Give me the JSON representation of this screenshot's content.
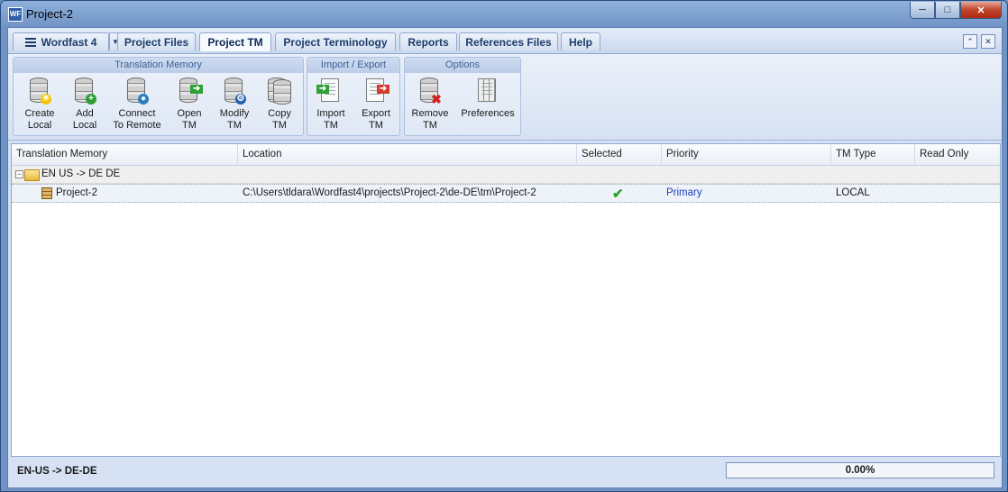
{
  "window": {
    "title": "Project-2",
    "icon_text": "WF"
  },
  "tabs": [
    {
      "label": "Wordfast 4"
    },
    {
      "label": "Project Files"
    },
    {
      "label": "Project TM"
    },
    {
      "label": "Project Terminology"
    },
    {
      "label": "Reports"
    },
    {
      "label": "References Files"
    },
    {
      "label": "Help"
    }
  ],
  "active_tab": "Project TM",
  "ribbon": {
    "groups": [
      {
        "title": "Translation Memory"
      },
      {
        "title": "Import / Export"
      },
      {
        "title": "Options"
      }
    ],
    "buttons": {
      "create_local": {
        "line1": "Create",
        "line2": "Local"
      },
      "add_local": {
        "line1": "Add",
        "line2": "Local"
      },
      "connect_remote": {
        "line1": "Connect",
        "line2": "To Remote"
      },
      "open_tm": {
        "line1": "Open",
        "line2": "TM"
      },
      "modify_tm": {
        "line1": "Modify",
        "line2": "TM"
      },
      "copy_tm": {
        "line1": "Copy",
        "line2": "TM"
      },
      "import_tm": {
        "line1": "Import",
        "line2": "TM"
      },
      "export_tm": {
        "line1": "Export",
        "line2": "TM"
      },
      "remove_tm": {
        "line1": "Remove",
        "line2": "TM"
      },
      "preferences": {
        "line1": "Preferences",
        "line2": ""
      }
    }
  },
  "grid": {
    "columns": [
      "Translation Memory",
      "Location",
      "Selected",
      "Priority",
      "TM Type",
      "Read Only"
    ],
    "group_label": "EN US -> DE DE",
    "rows": [
      {
        "name": "Project-2",
        "location": "C:\\Users\\tldara\\Wordfast4\\projects\\Project-2\\de-DE\\tm\\Project-2",
        "selected": true,
        "priority": "Primary",
        "tm_type": "LOCAL",
        "read_only": ""
      }
    ]
  },
  "status": {
    "language_pair": "EN-US -> DE-DE",
    "progress_text": "0.00%",
    "progress_fraction": 0
  },
  "colors": {
    "priority_text": "#1f3fbf",
    "check": "#29a329",
    "accent": "#1e3d6b"
  }
}
